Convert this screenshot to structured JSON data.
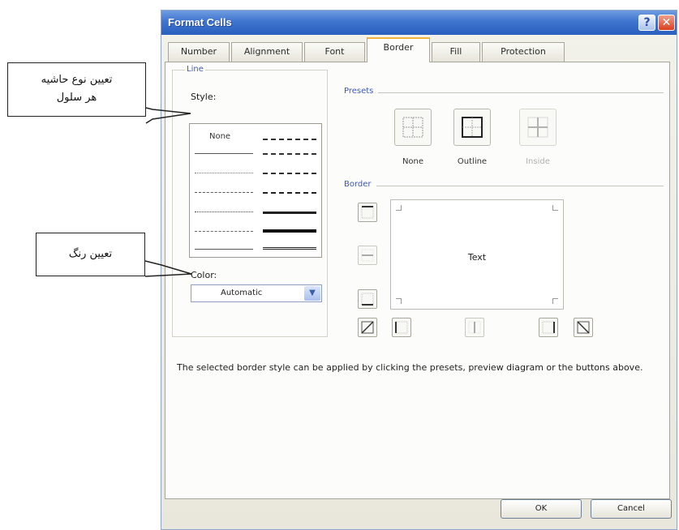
{
  "window": {
    "title": "Format Cells",
    "help_glyph": "?",
    "close_glyph": "✕"
  },
  "tabs": [
    {
      "label": "Number",
      "active": false
    },
    {
      "label": "Alignment",
      "active": false
    },
    {
      "label": "Font",
      "active": false
    },
    {
      "label": "Border",
      "active": true
    },
    {
      "label": "Fill",
      "active": false
    },
    {
      "label": "Protection",
      "active": false
    }
  ],
  "line": {
    "group_label": "Line",
    "style_label": "Style:",
    "style_none": "None",
    "color_label": "Color:",
    "color_value": "Automatic"
  },
  "presets": {
    "group_label": "Presets",
    "items": [
      {
        "label": "None",
        "enabled": true
      },
      {
        "label": "Outline",
        "enabled": true
      },
      {
        "label": "Inside",
        "enabled": false
      }
    ]
  },
  "border": {
    "group_label": "Border",
    "preview_text": "Text"
  },
  "hint": "The selected border style can be applied by clicking the presets, preview diagram or the buttons above.",
  "buttons": {
    "ok": "OK",
    "cancel": "Cancel"
  },
  "callouts": {
    "style_line1": "تعیین نوع حاشیه",
    "style_line2": "هر سلول",
    "color": "تعیین رنگ"
  },
  "colors": {
    "title_bar": "#2a5fbe",
    "accent_tab": "#f3b23c",
    "group_label": "#3f58b3"
  }
}
